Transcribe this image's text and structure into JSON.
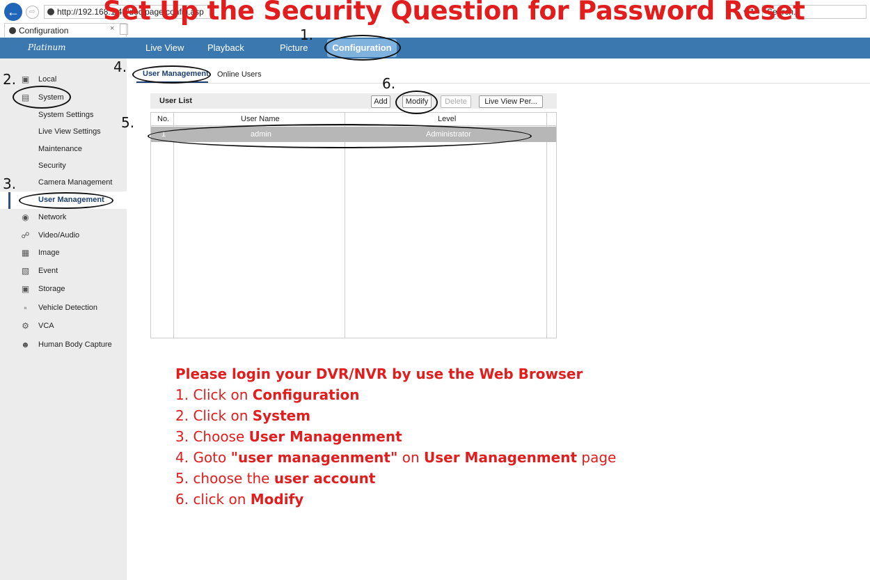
{
  "browser": {
    "address": "http://192.168.1.43/doc/page/config.asp",
    "address_visible": "http://192.168",
    "address_tail": "ge/config",
    "search_placeholder": "Search...",
    "tab_title": "Configuration",
    "tab_close": "×"
  },
  "overlay_title": "Set Up the Security Question for Password Reset",
  "topnav": {
    "brand": "Platinum",
    "items": [
      "Live View",
      "Playback",
      "Picture",
      "Configuration"
    ],
    "active": "Configuration"
  },
  "sidebar": {
    "groups": [
      {
        "label": "Local",
        "icon": "monitor-icon"
      },
      {
        "label": "System",
        "icon": "window-icon"
      }
    ],
    "system_items": [
      "System Settings",
      "Live View Settings",
      "Maintenance",
      "Security",
      "Camera Management",
      "User Management"
    ],
    "selected": "User Management",
    "other_groups": [
      {
        "label": "Network",
        "icon": "globe-icon"
      },
      {
        "label": "Video/Audio",
        "icon": "mic-camera-icon"
      },
      {
        "label": "Image",
        "icon": "image-icon"
      },
      {
        "label": "Event",
        "icon": "calendar-icon"
      },
      {
        "label": "Storage",
        "icon": "disk-icon"
      },
      {
        "label": "Vehicle Detection",
        "icon": "vehicle-icon"
      },
      {
        "label": "VCA",
        "icon": "vca-icon"
      },
      {
        "label": "Human Body Capture",
        "icon": "person-capture-icon"
      }
    ]
  },
  "subtabs": [
    "User Management",
    "Online Users"
  ],
  "user_list": {
    "title": "User List",
    "buttons": {
      "add": "Add",
      "modify": "Modify",
      "delete": "Delete",
      "live_view": "Live View Per..."
    },
    "columns": [
      "No.",
      "User Name",
      "Level"
    ],
    "rows": [
      {
        "no": "1",
        "user": "admin",
        "level": "Administrator"
      }
    ]
  },
  "annotations": {
    "n1": "1.",
    "n2": "2.",
    "n3": "3.",
    "n4": "4.",
    "n5": "5.",
    "n6": "6."
  },
  "instructions": {
    "heading": "Please login your DVR/NVR by use the Web Browser",
    "l1_pre": "1. Click on ",
    "l1_b": "Configuration",
    "l2_pre": "2. Click on ",
    "l2_b": "System",
    "l3_pre": "3. Choose ",
    "l3_b": "User Managenment",
    "l4_pre": "4. Goto ",
    "l4_b1": "\"user managenment\"",
    "l4_mid": " on ",
    "l4_b2": "User Managenment",
    "l4_post": " page",
    "l5_pre": "5. choose the ",
    "l5_b": "user account",
    "l6_pre": "6. click on ",
    "l6_b": "Modify"
  }
}
